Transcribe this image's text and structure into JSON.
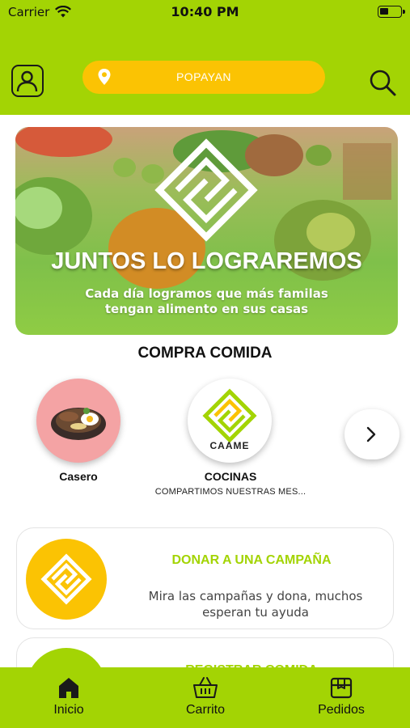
{
  "status_bar": {
    "carrier": "Carrier",
    "time": "10:40 PM"
  },
  "header": {
    "location": "POPAYAN",
    "profile_icon": "person-icon",
    "location_icon": "location-pin-icon",
    "search_icon": "search-icon"
  },
  "banner": {
    "title": "JUNTOS LO LOGRAREMOS",
    "subtitle": "Cada día logramos que más familas tengan alimento en sus casas"
  },
  "section": {
    "title": "COMPRA COMIDA"
  },
  "categories": [
    {
      "label": "Casero",
      "subtitle": ""
    },
    {
      "label": "COCINAS",
      "subtitle": "COMPARTIMOS NUESTRAS MES...",
      "logo_text": "CAAME"
    }
  ],
  "cards": [
    {
      "title": "DONAR A UNA CAMPAÑA",
      "description": "Mira las campañas y dona, muchos esperan tu ayuda"
    },
    {
      "title": "REGISTRAR COMIDA"
    }
  ],
  "tabbar": {
    "items": [
      {
        "label": "Inicio",
        "icon": "home-icon"
      },
      {
        "label": "Carrito",
        "icon": "basket-icon"
      },
      {
        "label": "Pedidos",
        "icon": "box-icon"
      }
    ]
  },
  "colors": {
    "brand_green": "#a3d404",
    "brand_yellow": "#fbc303",
    "casero_pink": "#f4a3a4"
  }
}
